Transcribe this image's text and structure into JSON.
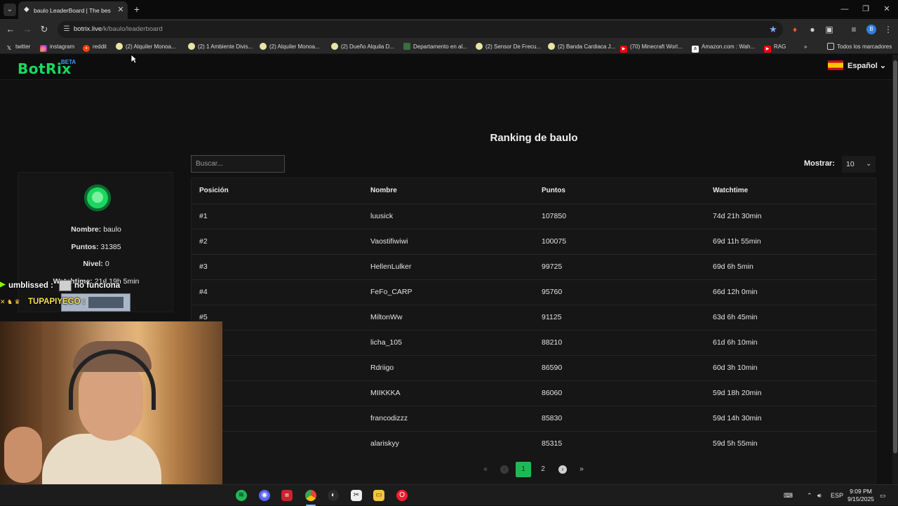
{
  "browser": {
    "tab_title": "baulo LeaderBoard | The best C",
    "url_host": "botrix.live",
    "url_path": "/k/baulo/leaderboard",
    "bookmarks": [
      {
        "label": "twitter",
        "icon": "x-icon"
      },
      {
        "label": "instagram",
        "icon": "instagram-icon"
      },
      {
        "label": "reddit",
        "icon": "reddit-icon"
      },
      {
        "label": "(2) Alquiler Monoa...",
        "icon": "marketplace-icon"
      },
      {
        "label": "(2) 1 Ambiente Divis...",
        "icon": "marketplace-icon"
      },
      {
        "label": "(2) Alquiler Monoa...",
        "icon": "marketplace-icon"
      },
      {
        "label": "(2) Dueño Alquila D...",
        "icon": "marketplace-icon"
      },
      {
        "label": "Departamento en al...",
        "icon": "image-icon"
      },
      {
        "label": "(2) Sensor De Frecu...",
        "icon": "marketplace-icon"
      },
      {
        "label": "(2) Banda Cardiaca J...",
        "icon": "marketplace-icon"
      },
      {
        "label": "(70) Minecraft Worl...",
        "icon": "youtube-icon"
      },
      {
        "label": "Amazon.com : Wah...",
        "icon": "amazon-icon"
      },
      {
        "label": "RAG",
        "icon": "youtube-icon"
      }
    ],
    "all_bookmarks_label": "Todos los marcadores",
    "profile_initial": "B"
  },
  "site": {
    "logo": "BotRix",
    "beta": "BETA",
    "language": "Español"
  },
  "leaderboard": {
    "title": "Ranking de baulo",
    "search_placeholder": "Buscar...",
    "show_label": "Mostrar:",
    "show_value": "10",
    "headers": {
      "position": "Posición",
      "name": "Nombre",
      "points": "Puntos",
      "watchtime": "Watchtime"
    },
    "rows": [
      {
        "position": "#1",
        "name": "luusick",
        "points": "107850",
        "watchtime": "74d 21h 30min"
      },
      {
        "position": "#2",
        "name": "Vaostifiwiwi",
        "points": "100075",
        "watchtime": "69d 11h 55min"
      },
      {
        "position": "#3",
        "name": "HellenLulker",
        "points": "99725",
        "watchtime": "69d 6h 5min"
      },
      {
        "position": "#4",
        "name": "FeFo_CARP",
        "points": "95760",
        "watchtime": "66d 12h 0min"
      },
      {
        "position": "#5",
        "name": "MiltonWw",
        "points": "91125",
        "watchtime": "63d 6h 45min"
      },
      {
        "position": "",
        "name": "licha_105",
        "points": "88210",
        "watchtime": "61d 6h 10min"
      },
      {
        "position": "",
        "name": "Rdriigo",
        "points": "86590",
        "watchtime": "60d 3h 10min"
      },
      {
        "position": "",
        "name": "MIIKKKA",
        "points": "86060",
        "watchtime": "59d 18h 20min"
      },
      {
        "position": "",
        "name": "francodizzz",
        "points": "85830",
        "watchtime": "59d 14h 30min"
      },
      {
        "position": "",
        "name": "alariskyy",
        "points": "85315",
        "watchtime": "59d 5h 55min"
      }
    ],
    "pagination": {
      "current": "1",
      "next": "2"
    }
  },
  "profile_card": {
    "name_label": "Nombre:",
    "name": "baulo",
    "points_label": "Puntos:",
    "points": "31385",
    "level_label": "Nivel:",
    "level": "0",
    "watchtime_label": "Watchtime:",
    "watchtime": "21d 19h 5min"
  },
  "chat_overlay": {
    "msg1_user": "umblissed :",
    "msg1_text": "no funciona",
    "msg2_user": "TUPAPIYEGO :"
  },
  "taskbar": {
    "lang": "ESP",
    "time": "9:09 PM",
    "date": "9/15/2025"
  },
  "colors": {
    "accent_green": "#1db954",
    "logo_green": "#1bd760",
    "beta_blue": "#36a0ff"
  }
}
